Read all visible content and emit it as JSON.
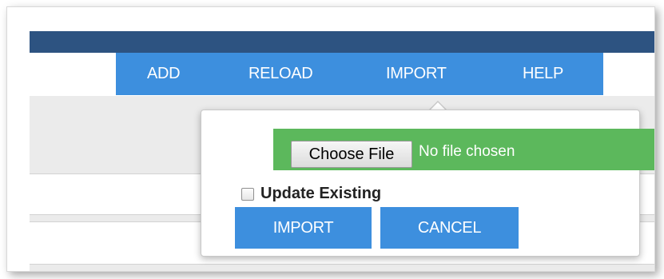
{
  "menu": {
    "items": [
      {
        "label": "ADD"
      },
      {
        "label": "RELOAD"
      },
      {
        "label": "IMPORT"
      },
      {
        "label": "HELP"
      }
    ]
  },
  "import_popover": {
    "choose_file_label": "Choose File",
    "file_status": "No file chosen",
    "update_existing_label": "Update Existing",
    "update_existing_checked": false,
    "import_button": "IMPORT",
    "cancel_button": "CANCEL"
  },
  "colors": {
    "header_bar": "#2d5381",
    "menu_bar": "#3d8fde",
    "file_strip": "#5cb85c",
    "button": "#3d8fde"
  }
}
